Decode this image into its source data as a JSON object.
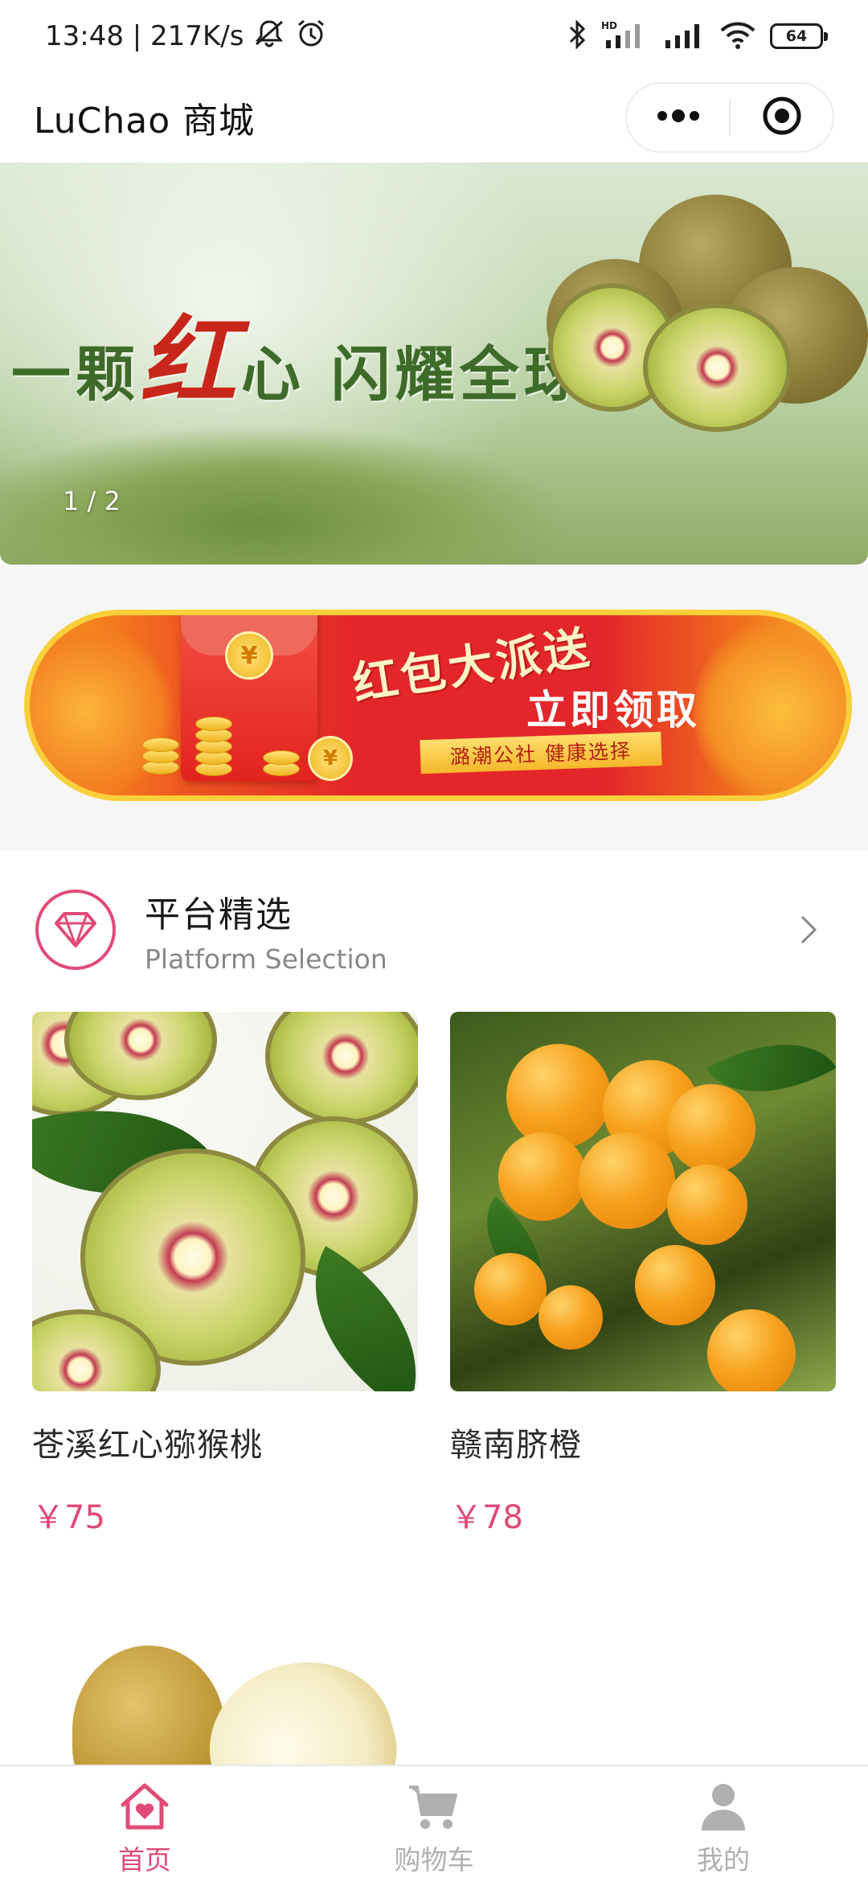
{
  "status_bar": {
    "time_speed": "13:48 | 217K/s",
    "battery": "64",
    "signal_label": "HD"
  },
  "header": {
    "title": "LuChao 商城"
  },
  "carousel": {
    "slogan_prefix": "一颗",
    "slogan_red": "红",
    "slogan_suffix": "心 闪耀全球",
    "counter": "1 / 2"
  },
  "promo": {
    "headline": "红包大派送",
    "cta": "立即领取",
    "ribbon": "潞潮公社  健康选择",
    "coin_symbol": "¥"
  },
  "section": {
    "title": "平台精选",
    "subtitle": "Platform Selection"
  },
  "products": [
    {
      "name": "苍溪红心猕猴桃",
      "price": "￥75"
    },
    {
      "name": "赣南脐橙",
      "price": "￥78"
    }
  ],
  "tabbar": {
    "items": [
      {
        "label": "首页",
        "icon": "home-heart-icon",
        "active": true
      },
      {
        "label": "购物车",
        "icon": "cart-icon",
        "active": false
      },
      {
        "label": "我的",
        "icon": "user-icon",
        "active": false
      }
    ]
  },
  "colors": {
    "accent": "#e04a76",
    "inactive": "#b0b0b0"
  }
}
